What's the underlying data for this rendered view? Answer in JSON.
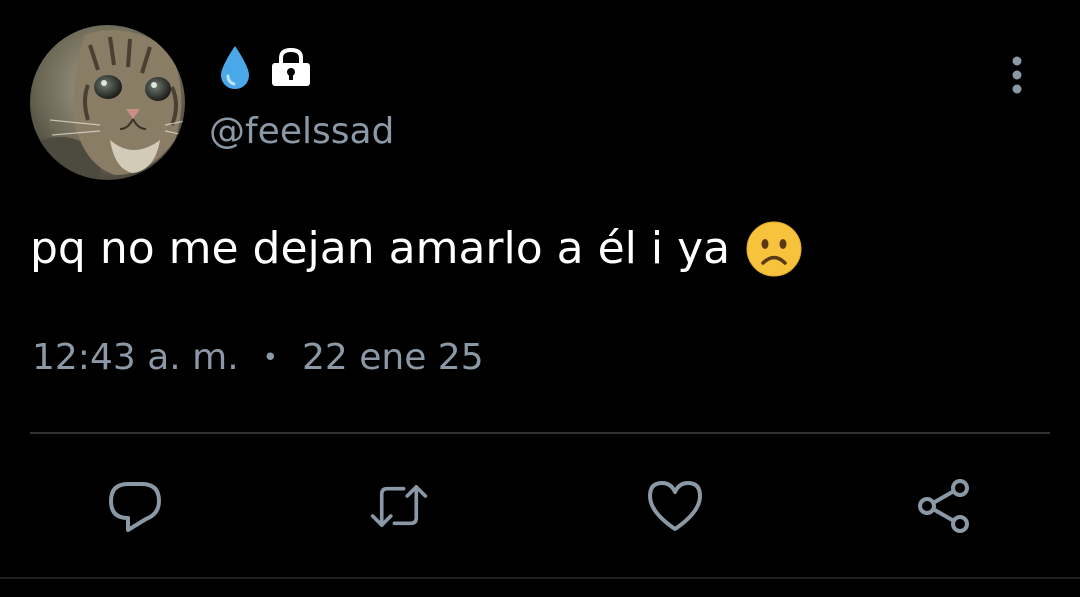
{
  "tweet": {
    "display_name_icons": [
      "droplet-icon",
      "lock-icon"
    ],
    "handle": "@feelssad",
    "text": "pq no me dejan amarlo a él i ya",
    "emoji": "frowning-face-emoji",
    "time": "12:43 a. m.",
    "separator": "•",
    "date": "22 ene 25"
  },
  "actions": [
    "reply-icon",
    "retweet-icon",
    "like-icon",
    "share-icon"
  ],
  "colors": {
    "background": "#000000",
    "text": "#ffffff",
    "secondary_text": "#8b98a5",
    "divider": "#2f3336",
    "droplet": "#4aa8e8",
    "emoji": "#f7c23c"
  }
}
